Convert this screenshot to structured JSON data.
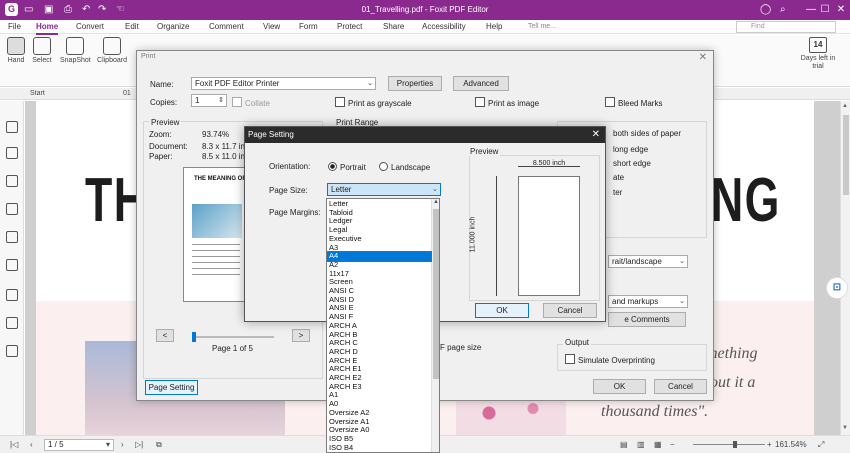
{
  "titlebar": {
    "app_glyph": "G",
    "title": "01_Travelling.pdf - Foxit PDF Editor",
    "qa_icons": [
      "folder-icon",
      "save-icon",
      "print-icon",
      "undo-icon",
      "redo-icon",
      "hand-icon"
    ],
    "user_icon": "user-icon",
    "search_icon": "search-icon",
    "minimize": "—",
    "maximize": "☐",
    "close": "✕"
  },
  "menu": {
    "items": [
      "File",
      "Home",
      "Convert",
      "Edit",
      "Organize",
      "Comment",
      "View",
      "Form",
      "Protect",
      "Share",
      "Accessibility",
      "Help"
    ],
    "active": "Home",
    "tell_me": "Tell me...",
    "find": "Find"
  },
  "ribbon": {
    "tools": [
      {
        "label": "Hand",
        "icon": "hand-icon"
      },
      {
        "label": "Select",
        "icon": "select-text-icon"
      },
      {
        "label": "SnapShot",
        "icon": "snapshot-icon"
      },
      {
        "label": "Clipboard",
        "icon": "clipboard-icon"
      }
    ],
    "days_left_value": "14",
    "days_left_label": "Days left in trial"
  },
  "tabs": {
    "start": "Start",
    "doc": "01"
  },
  "document": {
    "big_left": "TH",
    "big_right": "NG",
    "quote_lines": [
      "mething",
      "bout it a",
      "thousand times\"."
    ]
  },
  "statusbar": {
    "page": "1 / 5",
    "zoom": "161.54%"
  },
  "print_dialog": {
    "title": "Print",
    "name_label": "Name:",
    "printer": "Foxit PDF Editor Printer",
    "properties_btn": "Properties",
    "advanced_btn": "Advanced",
    "copies_label": "Copies:",
    "copies_value": "1",
    "collate": "Collate",
    "print_grayscale": "Print as grayscale",
    "print_image": "Print as image",
    "bleed_marks": "Bleed Marks",
    "preview_label": "Preview",
    "zoom_label": "Zoom:",
    "zoom_value": "93.74%",
    "document_label": "Document:",
    "document_value": "8.3 x 11.7 in",
    "paper_label": "Paper:",
    "paper_value": "8.5 x 11.0 in",
    "print_range": "Print Range",
    "preview_heading": "THE MEANING OF",
    "prev_btn": "<",
    "next_btn": ">",
    "page_of": "Page 1 of 5",
    "f_page_size": "F page size",
    "right_side": {
      "both_sides": "both sides of paper",
      "long_edge": "long edge",
      "short_edge": "short edge",
      "ate": "ate",
      "ter": "ter",
      "orientation_value": "rait/landscape",
      "comments_select": "and markups",
      "comments_btn": "e Comments"
    },
    "output_label": "Output",
    "simulate": "Simulate Overprinting",
    "page_setting_btn": "Page Setting",
    "ok": "OK",
    "cancel": "Cancel"
  },
  "page_setting": {
    "title": "Page Setting",
    "orientation_label": "Orientation:",
    "portrait": "Portrait",
    "landscape": "Landscape",
    "orientation_selected": "Portrait",
    "page_size_label": "Page Size:",
    "page_size_value": "Letter",
    "page_margins_label": "Page Margins:",
    "preview_label": "Preview",
    "width_dim": "8.500 inch",
    "height_dim": "11.000 inch",
    "ok": "OK",
    "cancel": "Cancel"
  },
  "size_options": [
    "Letter",
    "Tabloid",
    "Ledger",
    "Legal",
    "Executive",
    "A3",
    "A4",
    "A2",
    "11x17",
    "Screen",
    "ANSI C",
    "ANSI D",
    "ANSI E",
    "ANSI F",
    "ARCH A",
    "ARCH B",
    "ARCH C",
    "ARCH D",
    "ARCH E",
    "ARCH E1",
    "ARCH E2",
    "ARCH E3",
    "A1",
    "A0",
    "Oversize A2",
    "Oversize A1",
    "Oversize A0",
    "ISO B5",
    "ISO B4",
    "ISO B3"
  ],
  "size_highlighted": "A4",
  "colors": {
    "brand": "#8a2a8f",
    "selection": "#0078d7",
    "highlight_border": "#e03030"
  }
}
